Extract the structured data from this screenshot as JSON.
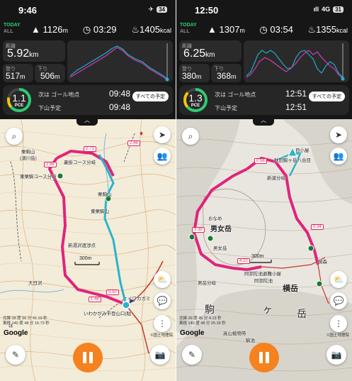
{
  "panels": [
    {
      "status": {
        "time": "9:46",
        "icons": "✈",
        "battery": "34",
        "signal": ""
      },
      "tabs": {
        "today": "TODAY",
        "all": "ALL"
      },
      "stats": {
        "ascent": "1126",
        "ascent_unit": "m",
        "time": "03:29",
        "calories": "1405",
        "calories_unit": "kcal"
      },
      "distance": {
        "label": "距離",
        "value": "5.92",
        "unit": "km"
      },
      "up": {
        "label": "登り",
        "value": "517",
        "unit": "m"
      },
      "down": {
        "label": "下り",
        "value": "506",
        "unit": "m"
      },
      "schedule": {
        "pce_value": "1.1",
        "pce_label": "PCE",
        "next_label": "次は ゴール地点",
        "next_time": "09:48",
        "descend_label": "下山予定",
        "descend_time": "09:48",
        "button": "すべての予定"
      },
      "map_labels": [
        "栗駒山",
        "(須川岳)",
        "裏掛コース分岐",
        "栗駒山",
        "東栗駒山",
        "東栗駒コース分岐",
        "新湯沢渡渉点",
        "大日沢",
        "いわかがみ平登山口(駐",
        "イワカガミ",
        "ほ"
      ],
      "scale": "300m",
      "km_tags": [
        "2.73",
        "2.46",
        "1.48",
        "2.98",
        "0.50"
      ],
      "coords": {
        "lat": "北緯 38 度 56 分 41.19 秒",
        "lon": "東経 140 度 48 分 16.73 秒"
      },
      "google": "Google",
      "gsi": "©国土地理院"
    },
    {
      "status": {
        "time": "12:50",
        "icons": "4G",
        "battery": "31",
        "signal": "ıll"
      },
      "tabs": {
        "today": "TODAY",
        "all": "ALL"
      },
      "stats": {
        "ascent": "1307",
        "ascent_unit": "m",
        "time": "03:54",
        "calories": "1355",
        "calories_unit": "kcal"
      },
      "distance": {
        "label": "距離",
        "value": "6.25",
        "unit": "km"
      },
      "up": {
        "label": "登り",
        "value": "380",
        "unit": "m"
      },
      "down": {
        "label": "下り",
        "value": "368",
        "unit": "m"
      },
      "schedule": {
        "pce_value": "1.3",
        "pce_label": "PCE",
        "next_label": "次は ゴール地点",
        "next_time": "12:51",
        "descend_label": "下山予定",
        "descend_time": "12:51",
        "button": "すべての予定"
      },
      "map_labels": [
        "目小屋",
        "秋田駒ヶ岳八合目",
        "新道分岐",
        "男女岳",
        "男女岳",
        "阿弥陀池避難小屋",
        "阿弥陀池",
        "男岳分岐",
        "横岳",
        "焼森",
        "ヶ",
        "岳",
        "駒",
        "高山植物帯",
        "駒池",
        "おなめ"
      ],
      "scale": "300m",
      "km_tags": [
        "0.56",
        "0.34",
        "3.39",
        "4.22"
      ],
      "coords": {
        "lat": "北緯 39 度 45 分 4.13 秒",
        "lon": "東経 140 度 48 分 25.39 秒"
      },
      "google": "Google",
      "gsi": "©国土地理院"
    }
  ],
  "colors": {
    "pace_green": "#2ecc71",
    "route": "#e0247a",
    "track": "#2bb3c8",
    "record": "#f5821f",
    "elev_magenta": "#d63fbf",
    "elev_cyan": "#1fb5d3"
  }
}
